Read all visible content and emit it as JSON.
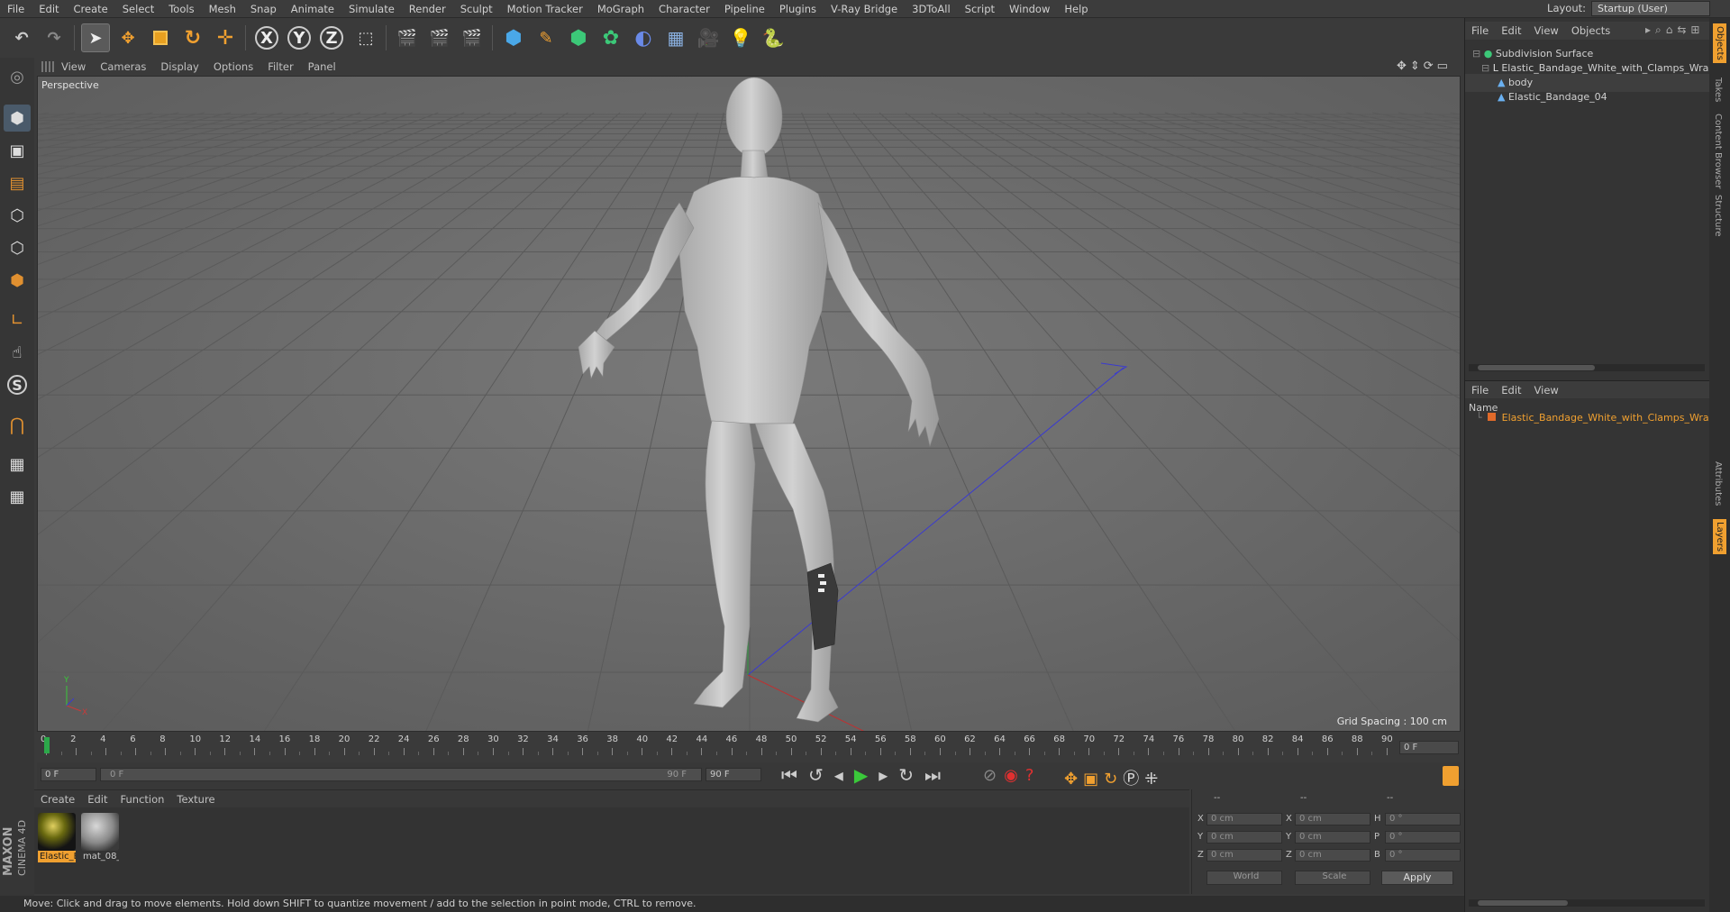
{
  "menu": [
    "File",
    "Edit",
    "Create",
    "Select",
    "Tools",
    "Mesh",
    "Snap",
    "Animate",
    "Simulate",
    "Render",
    "Sculpt",
    "Motion Tracker",
    "MoGraph",
    "Character",
    "Pipeline",
    "Plugins",
    "V-Ray Bridge",
    "3DToAll",
    "Script",
    "Window",
    "Help"
  ],
  "layout": {
    "label": "Layout:",
    "value": "Startup (User)"
  },
  "viewport": {
    "menu": [
      "View",
      "Cameras",
      "Display",
      "Options",
      "Filter",
      "Panel"
    ],
    "camera_label": "Perspective",
    "grid_spacing": "Grid Spacing : 100 cm"
  },
  "timeline": {
    "ticks": [
      "0",
      "2",
      "4",
      "6",
      "8",
      "10",
      "12",
      "14",
      "16",
      "18",
      "20",
      "22",
      "24",
      "26",
      "28",
      "30",
      "32",
      "34",
      "36",
      "38",
      "40",
      "42",
      "44",
      "46",
      "48",
      "50",
      "52",
      "54",
      "56",
      "58",
      "60",
      "62",
      "64",
      "66",
      "68",
      "70",
      "72",
      "74",
      "76",
      "78",
      "80",
      "82",
      "84",
      "86",
      "88",
      "90"
    ],
    "current_frame": "0 F",
    "start_field": "0 F",
    "range_start": "0 F",
    "range_end": "90 F",
    "end_field": "90 F"
  },
  "material_manager": {
    "menu": [
      "Create",
      "Edit",
      "Function",
      "Texture"
    ],
    "materials": [
      {
        "label": "Elastic_B",
        "selected": true
      },
      {
        "label": "mat_08_",
        "selected": false
      }
    ]
  },
  "coordinates": {
    "headers": [
      "--",
      "--",
      "--"
    ],
    "rows": [
      {
        "a": "X",
        "av": "0 cm",
        "b": "X",
        "bv": "0 cm",
        "c": "H",
        "cv": "0 °"
      },
      {
        "a": "Y",
        "av": "0 cm",
        "b": "Y",
        "bv": "0 cm",
        "c": "P",
        "cv": "0 °"
      },
      {
        "a": "Z",
        "av": "0 cm",
        "b": "Z",
        "bv": "0 cm",
        "c": "B",
        "cv": "0 °"
      }
    ],
    "mode": "World",
    "scale": "Scale",
    "apply": "Apply"
  },
  "status": "Move: Click and drag to move elements. Hold down SHIFT to quantize movement / add to the selection in point mode, CTRL to remove.",
  "object_manager": {
    "menu": [
      "File",
      "Edit",
      "View",
      "Objects"
    ],
    "tree": [
      {
        "label": "Subdivision Surface",
        "indent": 0
      },
      {
        "label": "Elastic_Bandage_White_with_Clamps_Wrapped",
        "indent": 1
      },
      {
        "label": "body",
        "indent": 2
      },
      {
        "label": "Elastic_Bandage_04",
        "indent": 2
      }
    ]
  },
  "layer_manager": {
    "menu": [
      "File",
      "Edit",
      "View"
    ],
    "column": "Name",
    "rows": [
      "Elastic_Bandage_White_with_Clamps_Wrapped"
    ]
  },
  "side_tabs": [
    "Objects",
    "Takes",
    "Content Browser",
    "Structure",
    "Attributes",
    "Layers"
  ],
  "brand": {
    "maxon": "MAXON",
    "product": "CINEMA 4D"
  }
}
